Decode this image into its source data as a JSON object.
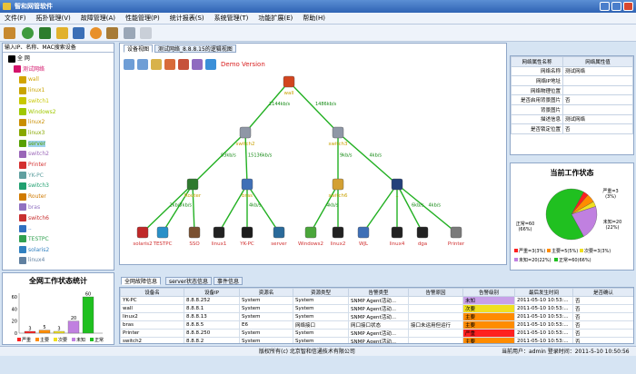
{
  "app": {
    "title": "智和网管软件"
  },
  "menu": [
    "文件(F)",
    "拓扑管理(V)",
    "故障管理(A)",
    "性能管理(P)",
    "统计报表(S)",
    "系统管理(T)",
    "功能扩展(E)",
    "帮助(H)"
  ],
  "left": {
    "search_placeholder": "输入IP、名称、MAC搜索设备",
    "tree": [
      {
        "label": "全 网",
        "color": "#000000",
        "icon": "globe-icon"
      },
      {
        "label": "测试网络",
        "color": "#d4146b",
        "icon": "network-icon"
      },
      {
        "label": "wall",
        "color": "#d2a400",
        "icon": "firewall-icon"
      },
      {
        "label": "linux1",
        "color": "#c9a400",
        "icon": "linux-icon"
      },
      {
        "label": "switch1",
        "color": "#c8c800",
        "icon": "switch-icon"
      },
      {
        "label": "Windows2",
        "color": "#a0c800",
        "icon": "windows-icon"
      },
      {
        "label": "linux2",
        "color": "#c98e00",
        "icon": "linux-icon"
      },
      {
        "label": "linux3",
        "color": "#88a800",
        "icon": "linux-icon"
      },
      {
        "label": "server",
        "color": "#58a000",
        "icon": "server-icon"
      },
      {
        "label": "switch2",
        "color": "#9a66b8",
        "icon": "switch-icon"
      },
      {
        "label": "Printer",
        "color": "#d43030",
        "icon": "printer-icon"
      },
      {
        "label": "YK-PC",
        "color": "#60a0a0",
        "icon": "pc-icon"
      },
      {
        "label": "switch3",
        "color": "#20a070",
        "icon": "switch-icon"
      },
      {
        "label": "Router",
        "color": "#d07a00",
        "icon": "router-icon"
      },
      {
        "label": "bras",
        "color": "#9070c0",
        "icon": "bras-icon"
      },
      {
        "label": "switch6",
        "color": "#c83030",
        "icon": "switch-icon"
      },
      {
        "label": "..",
        "color": "#3070c0",
        "icon": "device-icon"
      },
      {
        "label": "TESTPC",
        "color": "#30a050",
        "icon": "pc-icon"
      },
      {
        "label": "solaris2",
        "color": "#3080c0",
        "icon": "solaris-icon"
      },
      {
        "label": "linux4",
        "color": "#6080a0",
        "icon": "linux-icon"
      }
    ]
  },
  "stats": {
    "title": "全网工作状态统计",
    "legend": [
      "严重",
      "主要",
      "次要",
      "未知",
      "正常"
    ],
    "colors": [
      "#ff2020",
      "#ff8c00",
      "#f0e020",
      "#c080e0",
      "#20c020"
    ]
  },
  "chart_data": [
    {
      "type": "bar",
      "title": "全网工作状态统计",
      "categories": [
        "严重",
        "主要",
        "次要",
        "未知",
        "正常"
      ],
      "values": [
        3,
        5,
        3,
        20,
        60
      ],
      "ylim": [
        0,
        60
      ],
      "yticks": [
        0,
        20,
        40,
        60
      ],
      "grid": false,
      "legend": "bottom"
    },
    {
      "type": "pie",
      "title": "当前工作状态",
      "categories": [
        "严重",
        "主要",
        "次要",
        "未知",
        "正常"
      ],
      "values": [
        3,
        5,
        3,
        20,
        60
      ],
      "percents": [
        "3%",
        "5%",
        "3%",
        "22%",
        "66%"
      ],
      "labels": [
        "严重=3(3%)",
        "主要=5(5%)",
        "次要=3(3%)",
        "未知=20(22%)",
        "正常=60(66%)"
      ],
      "legend": "bottom"
    }
  ],
  "main": {
    "tabs": [
      "设备视图",
      "测试网络_8.8.8.15的逻辑视图"
    ],
    "demo": "Demo Version"
  },
  "topo": {
    "links": [
      "2144kb/s",
      "1486kb/s",
      "93kb/s",
      "15136kb/s",
      "9kb/s",
      "4kb/s",
      "2kb/s",
      "7kb/s",
      "4kb/s",
      "6kb/s",
      "4kb/s",
      "4kb/s"
    ],
    "nodes": [
      "wall",
      "switch2",
      "switch3",
      "Router",
      "bras",
      "switch6",
      "..",
      "solaris2",
      "TESTPC",
      "SSO",
      "linux1",
      "YK-PC",
      "server",
      "Windows2",
      "linux2",
      "WJL",
      "linux4",
      "dga",
      "Printer"
    ]
  },
  "props": {
    "headers": [
      "网络属性名称",
      "网络属性值"
    ],
    "rows": [
      {
        "k": "网络名称",
        "v": "测试网络"
      },
      {
        "k": "网络IP地址",
        "v": ""
      },
      {
        "k": "网络物理位置",
        "v": ""
      },
      {
        "k": "是否启用背景图片",
        "v": "否"
      },
      {
        "k": "背景图片",
        "v": ""
      },
      {
        "k": "描述信息",
        "v": "测试网络"
      },
      {
        "k": "是否锁定位置",
        "v": "否"
      }
    ]
  },
  "current": {
    "title": "当前工作状态",
    "severe": "严重=3",
    "severe_pct": "(3%)",
    "unknown": "未知=20",
    "unknown_pct": "(22%)",
    "normal": "正常=60",
    "normal_pct": "(66%)",
    "legend1": "严重=3(3%)",
    "legend2": "主要=5(5%)",
    "legend3": "次要=3(3%)",
    "legend4": "未知=20(22%)",
    "legend5": "正常=60(66%)"
  },
  "bottom": {
    "tabs": [
      "全网故障信息",
      "server状态信息",
      "事件信息"
    ],
    "headers": [
      "设备名",
      "设备IP",
      "资源名",
      "资源类型",
      "告警类型",
      "告警原因",
      "告警级别",
      "最后发生时间",
      "是否确认"
    ],
    "rows": [
      [
        "YK-PC",
        "8.8.8.252",
        "System",
        "System",
        "SNMP Agent活动...",
        "",
        "未知",
        "2011-05-10 10:53:...",
        "否"
      ],
      [
        "wall",
        "8.8.8.1",
        "System",
        "System",
        "SNMP Agent活动...",
        "",
        "次要",
        "2011-05-10 10:53:...",
        "否"
      ],
      [
        "linux2",
        "8.8.8.13",
        "System",
        "System",
        "SNMP Agent活动...",
        "",
        "主要",
        "2011-05-10 10:53:...",
        "否"
      ],
      [
        "bras",
        "8.8.8.5",
        "E6",
        "网络接口",
        "网口接口状态",
        "接口未运用但运行",
        "主要",
        "2011-05-10 10:53:...",
        "否"
      ],
      [
        "Printer",
        "8.8.8.250",
        "System",
        "System",
        "SNMP Agent活动...",
        "",
        "严重",
        "2011-05-10 10:53:...",
        "否"
      ],
      [
        "switch2",
        "8.8.8.2",
        "System",
        "System",
        "SNMP Agent活动...",
        "",
        "主要",
        "2011-05-10 10:53:...",
        "否"
      ]
    ],
    "level_colors": {
      "未知": "#c8a0e8",
      "次要": "#f0e020",
      "主要": "#ff8c00",
      "严重": "#ff2020"
    }
  },
  "status": {
    "center": "版权所有(c) 北京智和信通技术有限公司",
    "right": "当前用户：admin 登录时间：2011-5-10 10:50:56"
  }
}
